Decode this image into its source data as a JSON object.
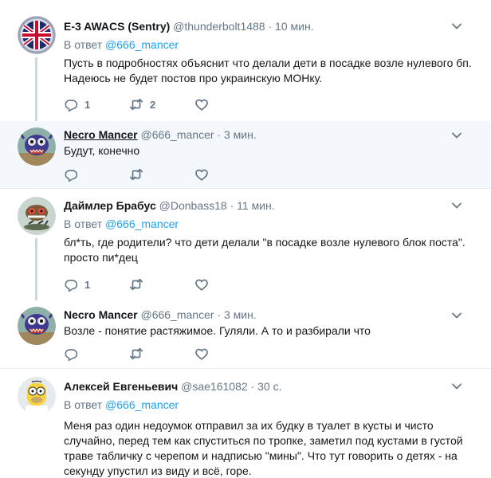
{
  "tweets": [
    {
      "name": "E-3 AWACS (Sentry)",
      "handle": "@thunderbolt1488",
      "dot": "·",
      "time": "10 мин.",
      "reply_prefix": "В ответ",
      "reply_to": "@666_mancer",
      "text": "Пусть в подробностях объяснит что делали дети в посадке возле нулевого бп. Надеюсь не будет постов про украинскую МОНку.",
      "reply_count": "1",
      "retweet_count": "2",
      "like_count": ""
    },
    {
      "name": "Necro Mancer",
      "handle": "@666_mancer",
      "dot": "·",
      "time": "3 мин.",
      "text": "Будут, конечно",
      "reply_count": "",
      "retweet_count": "",
      "like_count": ""
    },
    {
      "name": "Даймлер Брабус",
      "handle": "@Donbass18",
      "dot": "·",
      "time": "11 мин.",
      "reply_prefix": "В ответ",
      "reply_to": "@666_mancer",
      "text": "бл*ть, где родители? что дети делали \"в посадке возле нулевого блок поста\". просто пи*дец",
      "reply_count": "1",
      "retweet_count": "",
      "like_count": ""
    },
    {
      "name": "Necro Mancer",
      "handle": "@666_mancer",
      "dot": "·",
      "time": "3 мин.",
      "text": "Возле - понятие растяжимое. Гуляли. А то и разбирали что",
      "reply_count": "",
      "retweet_count": "",
      "like_count": ""
    },
    {
      "name": "Алексей Евгеньевич",
      "handle": "@sae161082",
      "dot": "·",
      "time": "30 с.",
      "reply_prefix": "В ответ",
      "reply_to": "@666_mancer",
      "text": "Меня раз один недоумок отправил за их будку в туалет в кусты и чисто случайно, перед тем как спуститься по тропке, заметил под кустами в густой траве табличку с черепом и надписью \"мины\". Что тут говорить о детях - на секунду упустил из виду и всё, горе."
    }
  ],
  "icons": {
    "reply": "reply-icon",
    "retweet": "retweet-icon",
    "like": "heart-icon",
    "more": "chevron-down-icon"
  },
  "colors": {
    "link": "#1da1f2",
    "muted": "#657786",
    "focused_bg": "#f5f8fa",
    "thread_line": "#ccd6dd"
  }
}
